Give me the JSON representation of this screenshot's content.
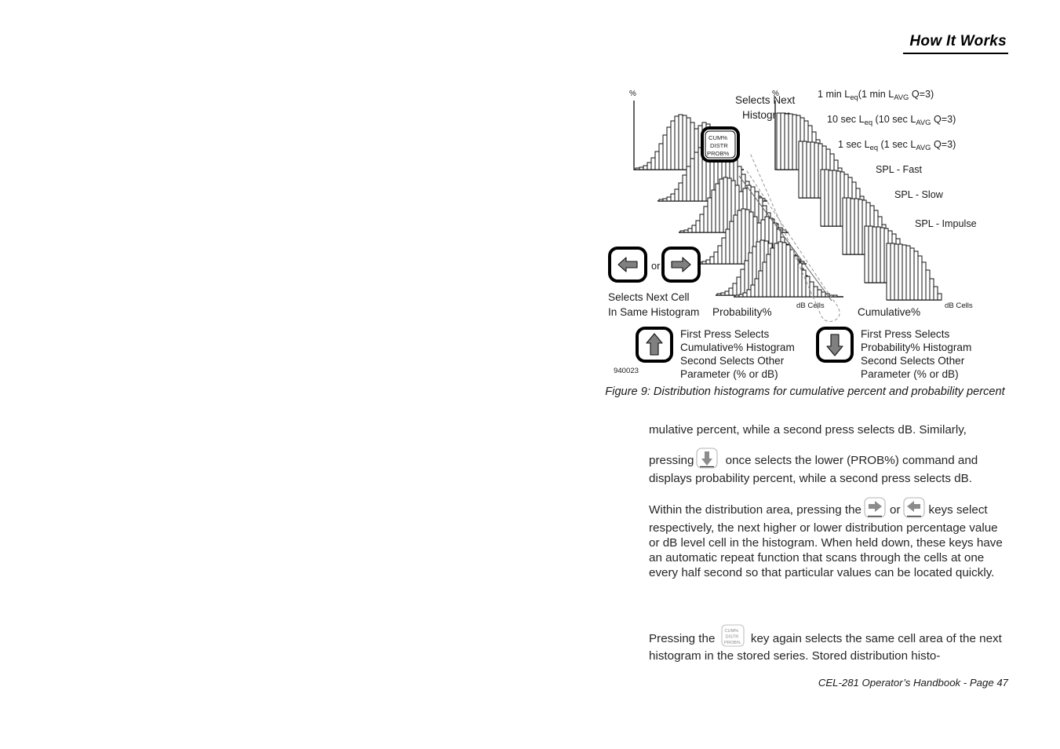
{
  "header": {
    "title": "How It Works"
  },
  "figure": {
    "id_code": "940023",
    "caption_line1": "Figure 9: Distribution histograms for cumulative percent and probability",
    "caption_line2": "percent",
    "axis_percent_left": "%",
    "axis_percent_right": "%",
    "db_cells_left": "dB Cells",
    "db_cells_right": "dB Cells",
    "probability_label": "Probability%",
    "cumulative_label": "Cumulative%",
    "selects_next_histogram_line1": "Selects Next",
    "selects_next_histogram_line2": "Histogram",
    "selects_next_cell_line1": "Selects Next Cell",
    "selects_next_cell_line2": "In Same Histogram",
    "or_label": "or",
    "cum_key": {
      "line1": "CUM%",
      "line2": "DISTR",
      "line3": "PROB%"
    },
    "up_key_note": [
      "First Press Selects",
      "Cumulative% Histogram",
      "Second Selects Other",
      "Parameter (% or dB)"
    ],
    "down_key_note": [
      "First Press Selects",
      "Probability% Histogram",
      "Second Selects Other",
      "Parameter (% or dB)"
    ],
    "series_labels": [
      {
        "id": "one-min-leq",
        "main_a": "1 min L",
        "sub_a": "eq",
        "main_b": "(1 min L",
        "sub_b": "AVG",
        "main_c": " Q=3)"
      },
      {
        "id": "ten-sec-leq",
        "main_a": "10 sec L",
        "sub_a": "eq",
        "main_b": " (10 sec L",
        "sub_b": "AVG",
        "main_c": "  Q=3)"
      },
      {
        "id": "one-sec-leq",
        "main_a": "1 sec L",
        "sub_a": "eq",
        "main_b": " (1 sec L",
        "sub_b": "AVG",
        "main_c": "  Q=3)"
      },
      {
        "id": "spl-fast",
        "main_a": "SPL - Fast",
        "sub_a": "",
        "main_b": "",
        "sub_b": "",
        "main_c": ""
      },
      {
        "id": "spl-slow",
        "main_a": "SPL - Slow",
        "sub_a": "",
        "main_b": "",
        "sub_b": "",
        "main_c": ""
      },
      {
        "id": "spl-impulse",
        "main_a": "SPL - Impulse",
        "sub_a": "",
        "main_b": "",
        "sub_b": "",
        "main_c": ""
      }
    ]
  },
  "body": {
    "para1": "mulative percent, while a second press selects dB. Similarly,",
    "para2_before": "pressing",
    "para2_after": "once selects the lower (PROB%) command and displays probability percent, while a second press selects dB.",
    "para3_before": "Within the distribution area, pressing the",
    "para3_mid": "or",
    "para3_after": "keys select respectively, the next higher or lower distribution percentage value or dB level cell in the histogram. When held down, these keys have an automatic repeat function that scans through the cells at one every half second so that particular values can be located quickly.",
    "para4_before": "Pressing the",
    "para4_after": "key again selects the same cell area of the next histogram in the stored series. Stored distribution histo-"
  },
  "footer": {
    "text": "CEL-281 Operator’s Handbook - Page 47"
  },
  "chart_data": {
    "type": "bar",
    "title": "Distribution histograms for cumulative percent and probability percent",
    "xlabel": "dB Cells",
    "ylabel": "%",
    "grid": false,
    "legend_position": "right",
    "panels": [
      {
        "name": "probability-percent-stack",
        "ylabel": "%",
        "xlabel": "dB Cells",
        "shape": "bell",
        "series": [
          {
            "name": "1 min Leq (1 min LAVG Q=3)",
            "values": [
              1,
              1,
              2,
              3,
              5,
              9,
              15,
              23,
              33,
              44,
              54,
              62,
              68,
              70,
              69,
              66,
              60,
              52,
              43,
              34,
              26,
              19,
              13,
              9,
              6,
              4,
              2,
              1,
              1
            ]
          },
          {
            "name": "10 sec Leq (10 sec LAVG Q=3)",
            "values": [
              1,
              1,
              2,
              3,
              5,
              9,
              15,
              23,
              33,
              44,
              54,
              62,
              68,
              70,
              69,
              66,
              60,
              52,
              43,
              34,
              26,
              19,
              13,
              9,
              6,
              4,
              2,
              1,
              1
            ]
          },
          {
            "name": "1 sec Leq (1 sec LAVG Q=3)",
            "values": [
              1,
              1,
              2,
              3,
              5,
              9,
              15,
              23,
              33,
              44,
              54,
              62,
              68,
              70,
              69,
              66,
              60,
              52,
              43,
              34,
              26,
              19,
              13,
              9,
              6,
              4,
              2,
              1,
              1
            ]
          },
          {
            "name": "SPL - Fast",
            "values": [
              1,
              1,
              2,
              3,
              5,
              9,
              15,
              23,
              33,
              44,
              54,
              62,
              68,
              70,
              69,
              66,
              60,
              52,
              43,
              34,
              26,
              19,
              13,
              9,
              6,
              4,
              2,
              1,
              1
            ]
          },
          {
            "name": "SPL - Slow",
            "values": [
              1,
              1,
              2,
              3,
              5,
              9,
              15,
              23,
              33,
              44,
              54,
              62,
              68,
              70,
              69,
              66,
              60,
              52,
              43,
              34,
              26,
              19,
              13,
              9,
              6,
              4,
              2,
              1,
              1
            ]
          },
          {
            "name": "SPL - Impulse",
            "values": [
              1,
              1,
              2,
              3,
              5,
              9,
              15,
              23,
              33,
              44,
              54,
              62,
              68,
              70,
              69,
              66,
              60,
              52,
              43,
              34,
              26,
              19,
              13,
              9,
              6,
              4,
              2,
              1,
              1
            ]
          }
        ]
      },
      {
        "name": "cumulative-percent-stack",
        "ylabel": "%",
        "xlabel": "dB Cells",
        "shape": "descending-staircase",
        "series": [
          {
            "name": "1 min Leq (1 min LAVG Q=3)",
            "values": [
              100,
              100,
              99,
              99,
              98,
              97,
              95,
              92,
              88,
              82,
              74,
              64,
              53,
              42,
              31,
              22,
              15,
              9,
              6,
              3,
              2,
              1,
              1
            ]
          },
          {
            "name": "10 sec Leq (10 sec LAVG Q=3)",
            "values": [
              100,
              100,
              99,
              99,
              98,
              97,
              95,
              92,
              88,
              82,
              74,
              64,
              53,
              42,
              31,
              22,
              15,
              9,
              6,
              3,
              2,
              1,
              1
            ]
          },
          {
            "name": "1 sec Leq (1 sec LAVG Q=3)",
            "values": [
              100,
              100,
              99,
              99,
              98,
              97,
              95,
              92,
              88,
              82,
              74,
              64,
              53,
              42,
              31,
              22,
              15,
              9,
              6,
              3,
              2,
              1,
              1
            ]
          },
          {
            "name": "SPL - Fast",
            "values": [
              100,
              100,
              99,
              99,
              98,
              97,
              95,
              92,
              88,
              82,
              74,
              64,
              53,
              42,
              31,
              22,
              15,
              9,
              6,
              3,
              2,
              1,
              1
            ]
          },
          {
            "name": "SPL - Slow",
            "values": [
              100,
              100,
              99,
              99,
              98,
              97,
              95,
              92,
              88,
              82,
              74,
              64,
              53,
              42,
              31,
              22,
              15,
              9,
              6,
              3,
              2,
              1,
              1
            ]
          },
          {
            "name": "SPL - Impulse",
            "values": [
              100,
              100,
              99,
              99,
              98,
              97,
              95,
              92,
              88,
              82,
              74,
              64,
              53,
              42,
              31,
              22,
              15,
              9,
              6,
              3,
              2,
              1,
              1
            ]
          }
        ]
      }
    ]
  }
}
